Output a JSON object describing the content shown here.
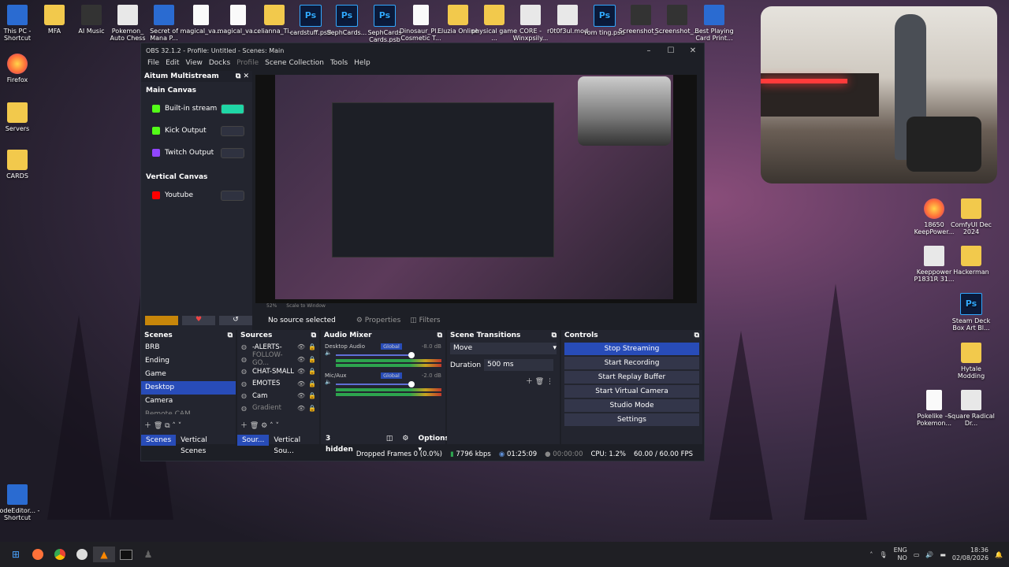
{
  "desktop_top_icons": [
    {
      "label": "This PC - Shortcut",
      "type": "app"
    },
    {
      "label": "MFA",
      "type": "folder"
    },
    {
      "label": "AI Music",
      "type": "dark"
    },
    {
      "label": "Pokemon_ Auto Chess",
      "type": "white"
    },
    {
      "label": "Secret of Mana P...",
      "type": "app"
    },
    {
      "label": "magical_va...",
      "type": "doc"
    },
    {
      "label": "magical_va...",
      "type": "doc"
    },
    {
      "label": "celianna_Ti...",
      "type": "folder"
    },
    {
      "label": "cardstuff.psd",
      "type": "ps"
    },
    {
      "label": "SephCards...",
      "type": "ps"
    },
    {
      "label": "SephCards Cards.psb",
      "type": "ps"
    },
    {
      "label": "Dinosaur_Pl... Cosmetic T...",
      "type": "doc"
    },
    {
      "label": "Eluzia Online",
      "type": "folder"
    },
    {
      "label": "physical game ...",
      "type": "folder"
    },
    {
      "label": "CORE - Winxpsily...",
      "type": "white"
    },
    {
      "label": "r0t0f3ul.mod",
      "type": "white"
    },
    {
      "label": "rom ting.psd",
      "type": "ps"
    },
    {
      "label": "Screenshot_...",
      "type": "dark"
    },
    {
      "label": "Screenshot_...",
      "type": "dark"
    },
    {
      "label": "Best Playing Card Print...",
      "type": "app"
    }
  ],
  "desktop_left_icons": [
    {
      "label": "Firefox",
      "type": "ff"
    },
    {
      "label": "Servers",
      "type": "folder"
    },
    {
      "label": "CARDS",
      "type": "folder"
    },
    {
      "label": "NodeEditor... - Shortcut",
      "type": "app"
    }
  ],
  "desktop_right_icons": [
    {
      "label": "18650 KeepPower...",
      "type": "ff"
    },
    {
      "label": "ComfyUI Dec 2024",
      "type": "folder"
    },
    {
      "label": "Keeppower P1831R 31...",
      "type": "white"
    },
    {
      "label": "Hackerman",
      "type": "folder"
    },
    {
      "label": "Steam Deck Box Art Bl...",
      "type": "ps"
    },
    {
      "label": "Hytale Modding",
      "type": "folder"
    },
    {
      "label": "Pokelike — Pokemon...",
      "type": "doc"
    },
    {
      "label": "Square Radical Dr...",
      "type": "white"
    }
  ],
  "obs": {
    "title": "OBS 32.1.2 - Profile: Untitled - Scenes: Main",
    "menu": [
      "File",
      "Edit",
      "View",
      "Docks",
      "Profile",
      "Scene Collection",
      "Tools",
      "Help"
    ],
    "multistream": {
      "header": "Aitum Multistream",
      "main_canvas_label": "Main Canvas",
      "vertical_canvas_label": "Vertical Canvas",
      "main_outputs": [
        {
          "label": "Built-in stream",
          "color": "#53fc18",
          "active": true
        },
        {
          "label": "Kick Output",
          "color": "#53fc18",
          "active": false
        },
        {
          "label": "Twitch Output",
          "color": "#9146ff",
          "active": false
        }
      ],
      "vertical_outputs": [
        {
          "label": "Youtube",
          "color": "#ff0000",
          "active": false
        }
      ]
    },
    "scale_label": "Scale to Window",
    "zoom": "52%",
    "no_source": "No source selected",
    "properties": "Properties",
    "filters": "Filters",
    "scenes": {
      "header": "Scenes",
      "items": [
        "BRB",
        "Ending",
        "Game",
        "Desktop",
        "Camera",
        "Remote CAM"
      ],
      "selected": "Desktop",
      "tab1": "Scenes",
      "tab2": "Vertical Scenes"
    },
    "sources": {
      "header": "Sources",
      "items": [
        {
          "label": "-ALERTS-",
          "dim": false
        },
        {
          "label": "FOLLOW-GO...",
          "dim": true
        },
        {
          "label": "CHAT-SMALL",
          "dim": false
        },
        {
          "label": "EMOTES",
          "dim": false
        },
        {
          "label": "Cam",
          "dim": false
        },
        {
          "label": "Gradient",
          "dim": true
        }
      ],
      "tab1": "Sour...",
      "tab2": "Vertical Sou..."
    },
    "mixer": {
      "header": "Audio Mixer",
      "channels": [
        {
          "name": "Desktop Audio",
          "db": "-8.0 dB",
          "badge": "Global"
        },
        {
          "name": "Mic/Aux",
          "db": "-2.0 dB",
          "badge": "Global"
        }
      ],
      "hidden": "3 hidden",
      "options": "Options"
    },
    "transitions": {
      "header": "Scene Transitions",
      "type": "Move",
      "duration_label": "Duration",
      "duration_value": "500 ms"
    },
    "controls": {
      "header": "Controls",
      "buttons": [
        "Stop Streaming",
        "Start Recording",
        "Start Replay Buffer",
        "Start Virtual Camera",
        "Studio Mode",
        "Settings"
      ]
    },
    "status": {
      "dropped": "Dropped Frames 0 (0.0%)",
      "bitrate": "7796 kbps",
      "live_time": "01:25:09",
      "rec_time": "00:00:00",
      "cpu": "CPU: 1.2%",
      "fps": "60.00 / 60.00 FPS"
    }
  },
  "taskbar": {
    "lang1": "ENG",
    "lang2": "NO",
    "time": "18:36",
    "date": "02/08/2026"
  }
}
